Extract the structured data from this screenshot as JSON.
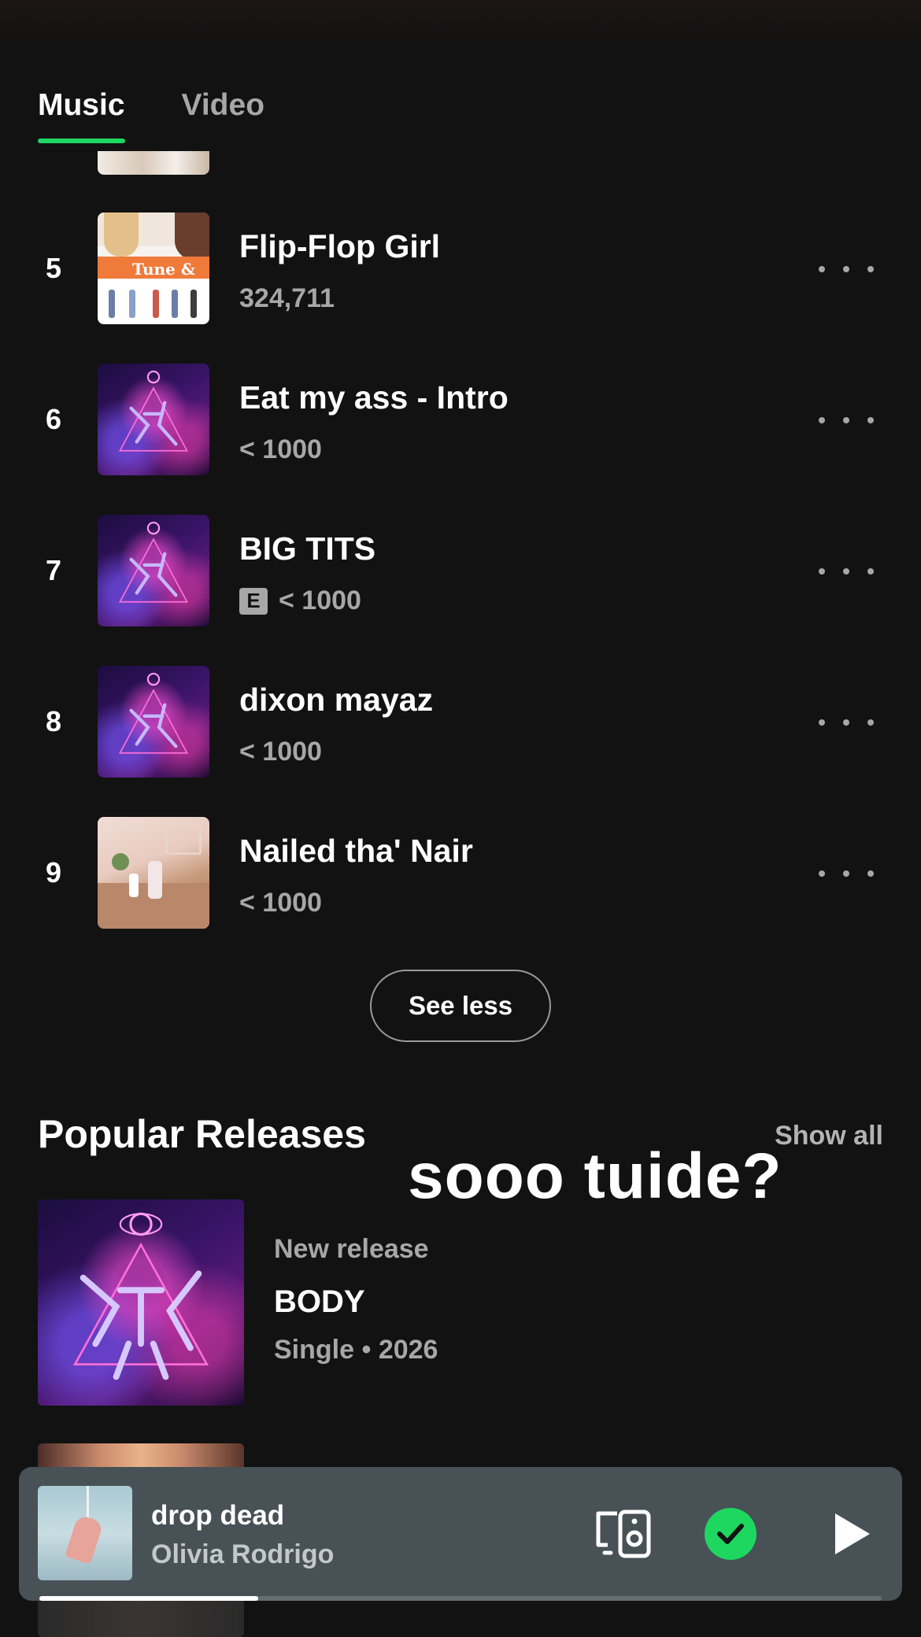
{
  "tabs": {
    "music": "Music",
    "video": "Video"
  },
  "tracks": [
    {
      "rank": "5",
      "title": "Flip-Flop Girl",
      "plays": "324,711",
      "explicit": false,
      "art_text": "Tune & Play"
    },
    {
      "rank": "6",
      "title": "Eat my ass - Intro",
      "plays": "< 1000",
      "explicit": false
    },
    {
      "rank": "7",
      "title": "BIG TITS",
      "plays": "< 1000",
      "explicit": true,
      "explicit_badge": "E"
    },
    {
      "rank": "8",
      "title": "dixon mayaz",
      "plays": "< 1000",
      "explicit": false
    },
    {
      "rank": "9",
      "title": "Nailed tha' Nair",
      "plays": "< 1000",
      "explicit": false
    }
  ],
  "see_less_label": "See less",
  "popular_releases": {
    "title": "Popular Releases",
    "show_all": "Show all",
    "overlay_caption": "sooo tuide?",
    "items": [
      {
        "kicker": "New release",
        "title": "BODY",
        "meta": "Single • 2026"
      }
    ]
  },
  "now_playing": {
    "title": "drop dead",
    "artist": "Olivia Rodrigo",
    "progress": 0.26,
    "icons": {
      "devices": "devices-speaker-icon",
      "saved": "check-saved-icon",
      "play": "play-icon"
    }
  },
  "colors": {
    "accent": "#1ed760",
    "background": "#121212",
    "mini_player": "#475156",
    "secondary_text": "#a7a7a7"
  }
}
